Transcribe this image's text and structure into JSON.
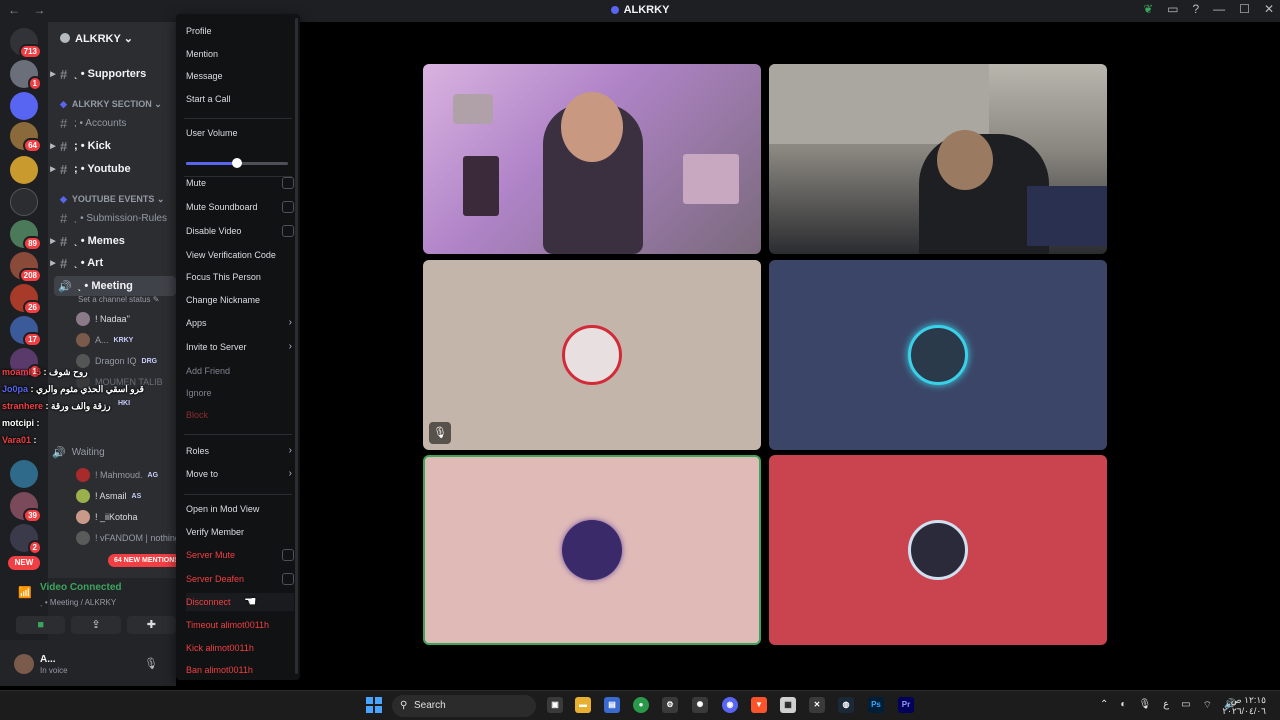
{
  "titlebar": {
    "title": "ALKRKY",
    "back": "←",
    "forward": "→"
  },
  "server": {
    "name": "ALKRKY ⌄"
  },
  "rail_badges": [
    "713",
    "1",
    "64",
    "89",
    "208",
    "26",
    "17",
    "1",
    "39",
    "2"
  ],
  "rail_new": "NEW",
  "channels": {
    "supporters": "ˎ • Supporters",
    "cat_alkrky": "ALKRKY SECTION ⌄",
    "accounts": "; • Accounts",
    "kick": "; • Kick",
    "youtube": "; • Youtube",
    "cat_youtube": "YOUTUBE EVENTS ⌄",
    "submission": "ˎ • Submission-Rules",
    "memes": "ˎ • Memes",
    "art": "ˎ • Art",
    "meeting": "ˎ • Meeting",
    "meeting_status": "Set a channel status ✎",
    "waiting": "Waiting"
  },
  "voice_users": {
    "u1": "! Nadaa''",
    "u2": "A...",
    "u2_tag": "KRKY",
    "u3": "Dragon IQ",
    "u3_tag": "DRG",
    "u4": "MOUMEN TALIB",
    "u5": "HKI",
    "w1": "! Mahmoud.",
    "w1_tag": "AG",
    "w2": "! Asmail",
    "w2_tag": "AS",
    "w3": "! _iiKotoha",
    "w4": "! vFANDOM | nothing"
  },
  "overlay_chat": [
    {
      "name": "moaml_5",
      "text": ": روح شوف"
    },
    {
      "name": "Jo0pa",
      "text": ": قرو اسقي الحذي مثوم والري"
    },
    {
      "name": "stranhere",
      "text": ": رزقة والف ورقة"
    },
    {
      "name": "motcipi",
      "text": ":"
    },
    {
      "name": "Vara01",
      "text": ":"
    }
  ],
  "mention_pill": "64 NEW MENTIONS",
  "voice_panel": {
    "status": "Video Connected",
    "sub": "ˎ • Meeting / ALKRKY"
  },
  "user_panel": {
    "name": "A...",
    "status": "In voice"
  },
  "context_menu": {
    "profile": "Profile",
    "mention": "Mention",
    "message": "Message",
    "start_call": "Start a Call",
    "user_volume": "User Volume",
    "volume_level": 0.5,
    "mute": "Mute",
    "mute_soundboard": "Mute Soundboard",
    "disable_video": "Disable Video",
    "view_verification": "View Verification Code",
    "focus": "Focus This Person",
    "change_nickname": "Change Nickname",
    "apps": "Apps",
    "invite": "Invite to Server",
    "add_friend": "Add Friend",
    "ignore": "Ignore",
    "block": "Block",
    "roles": "Roles",
    "move_to": "Move to",
    "mod_view": "Open in Mod View",
    "verify": "Verify Member",
    "server_mute": "Server Mute",
    "server_deafen": "Server Deafen",
    "disconnect": "Disconnect",
    "timeout": "Timeout alimot0011h",
    "kick": "Kick alimot0011h",
    "ban": "Ban alimot0011h"
  },
  "taskbar": {
    "search": "Search",
    "time": "١٢:١٥ ص",
    "date": "٢٠٢٦/٠٤/٠٦",
    "lang": "ع"
  },
  "colors": {
    "blurple": "#5865f2",
    "green": "#3ba55c",
    "red": "#f23f43"
  }
}
